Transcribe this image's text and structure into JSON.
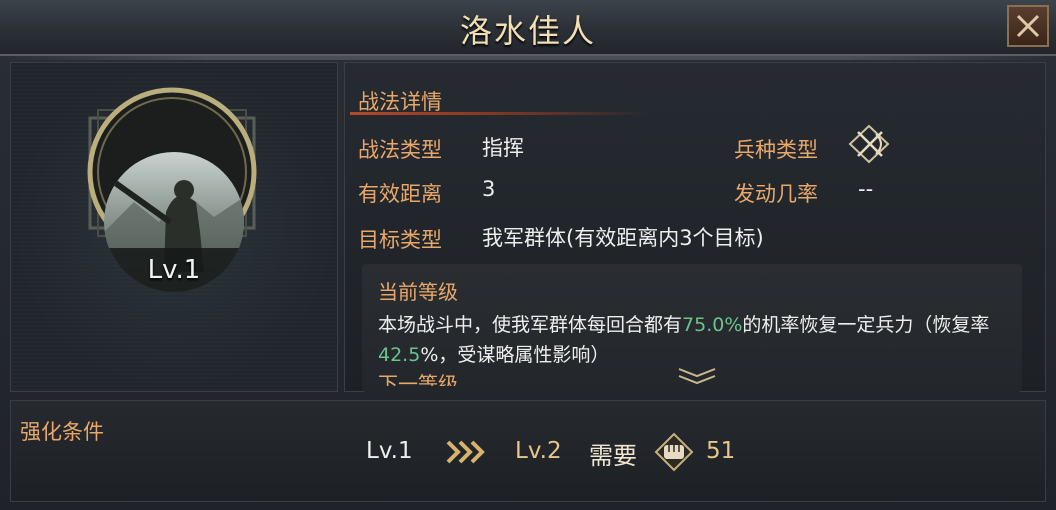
{
  "window": {
    "title": "洛水佳人"
  },
  "icons": {
    "close": "close-icon",
    "troop_type": "crossed-weapons-icon",
    "arrows": "triple-chevron-right-icon",
    "cost": "fist-icon",
    "scroll": "double-chevron-down-icon"
  },
  "skill": {
    "level_badge": "Lv.1"
  },
  "details": {
    "section_title": "战法详情",
    "type_label": "战法类型",
    "type_value": "指挥",
    "troop_label": "兵种类型",
    "range_label": "有效距离",
    "range_value": "3",
    "rate_label": "发动几率",
    "rate_value": "--",
    "target_label": "目标类型",
    "target_value": "我军群体(有效距离内3个目标)"
  },
  "current_level": {
    "title": "当前等级",
    "desc_part1": "本场战斗中，使我军群体每回合都有",
    "desc_rate": "75.0%",
    "desc_part2": "的机率恢复一定兵力（恢复率",
    "desc_recover": "42.5",
    "desc_part3": "%，受谋略属性影响）"
  },
  "next_level": {
    "title": "下一等级"
  },
  "upgrade": {
    "label": "强化条件",
    "from": "Lv.1",
    "to": "Lv.2",
    "need": "需要",
    "cost": "51"
  },
  "colors": {
    "label": "#e9a869",
    "highlight_green": "#6cc38e",
    "gold": "#e7c68c"
  }
}
